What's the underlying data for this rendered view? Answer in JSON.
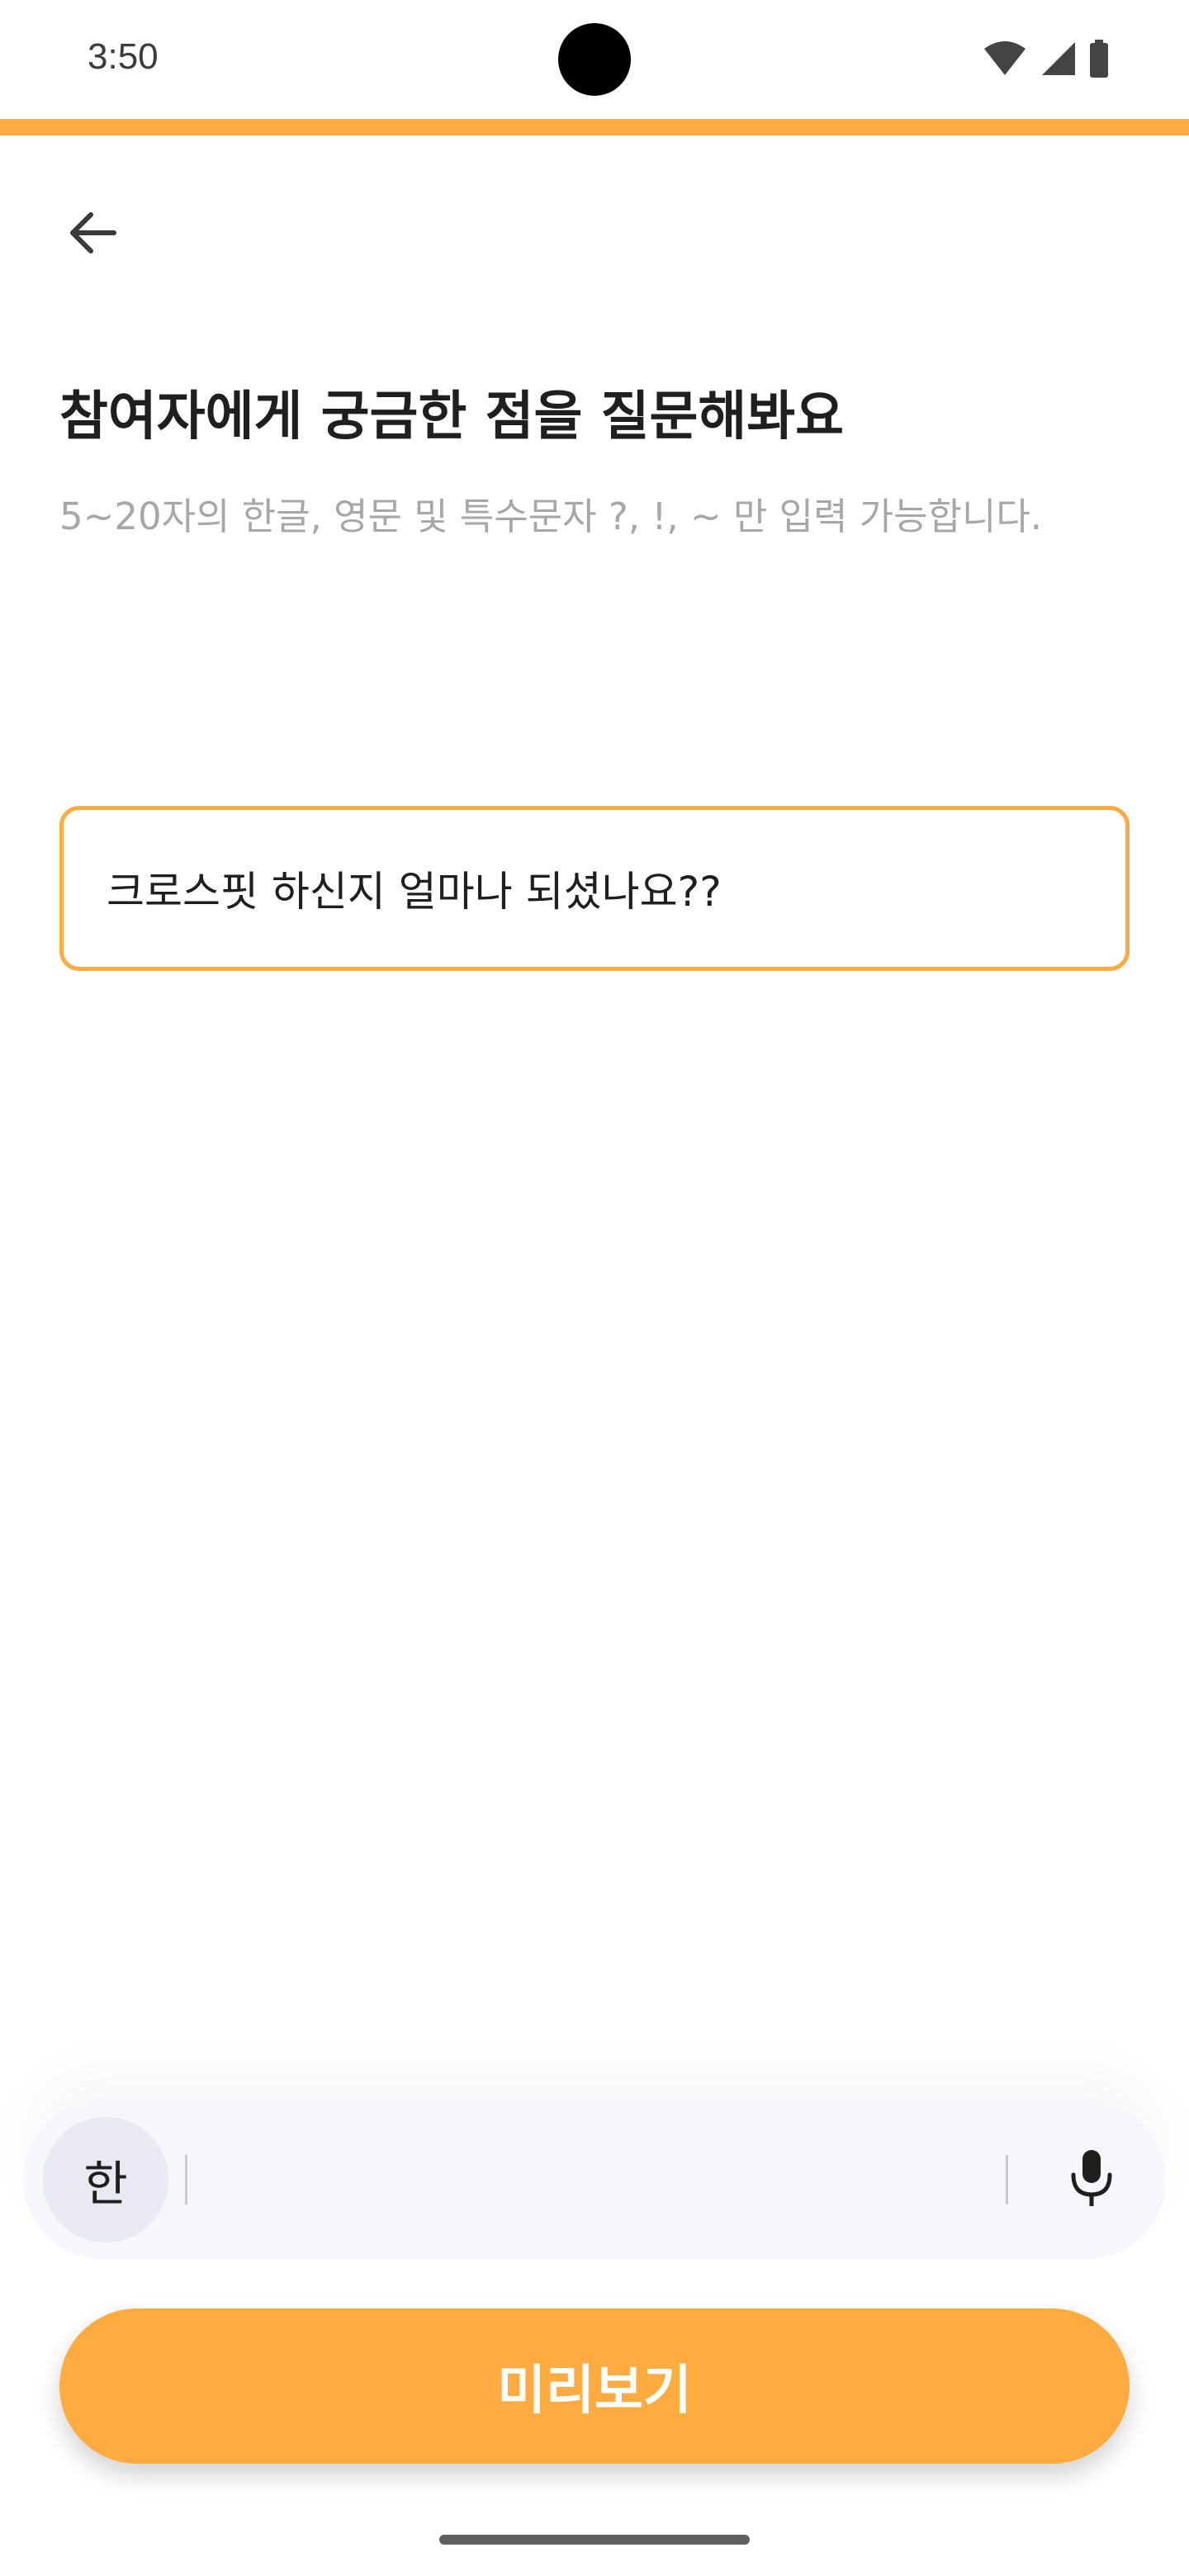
{
  "status_bar": {
    "time": "3:50",
    "icons": [
      "wifi-icon",
      "cell-signal-icon",
      "battery-icon"
    ]
  },
  "header": {
    "back_icon": "arrow-left-icon"
  },
  "content": {
    "title": "참여자에게 궁금한 점을 질문해봐요",
    "hint": "5~20자의 한글, 영문 및 특수문자 ?, !, ~ 만 입력 가능합니다.",
    "question_value": "크로스핏 하신지 얼마나 되셨나요??"
  },
  "keyboard": {
    "lang_label": "한",
    "mic_icon": "microphone-icon"
  },
  "actions": {
    "preview_label": "미리보기"
  },
  "colors": {
    "accent": "#ffab40",
    "title": "#1f1f1f",
    "hint": "#a7a7a7",
    "keyboard_strip": "#f6f6fb"
  }
}
